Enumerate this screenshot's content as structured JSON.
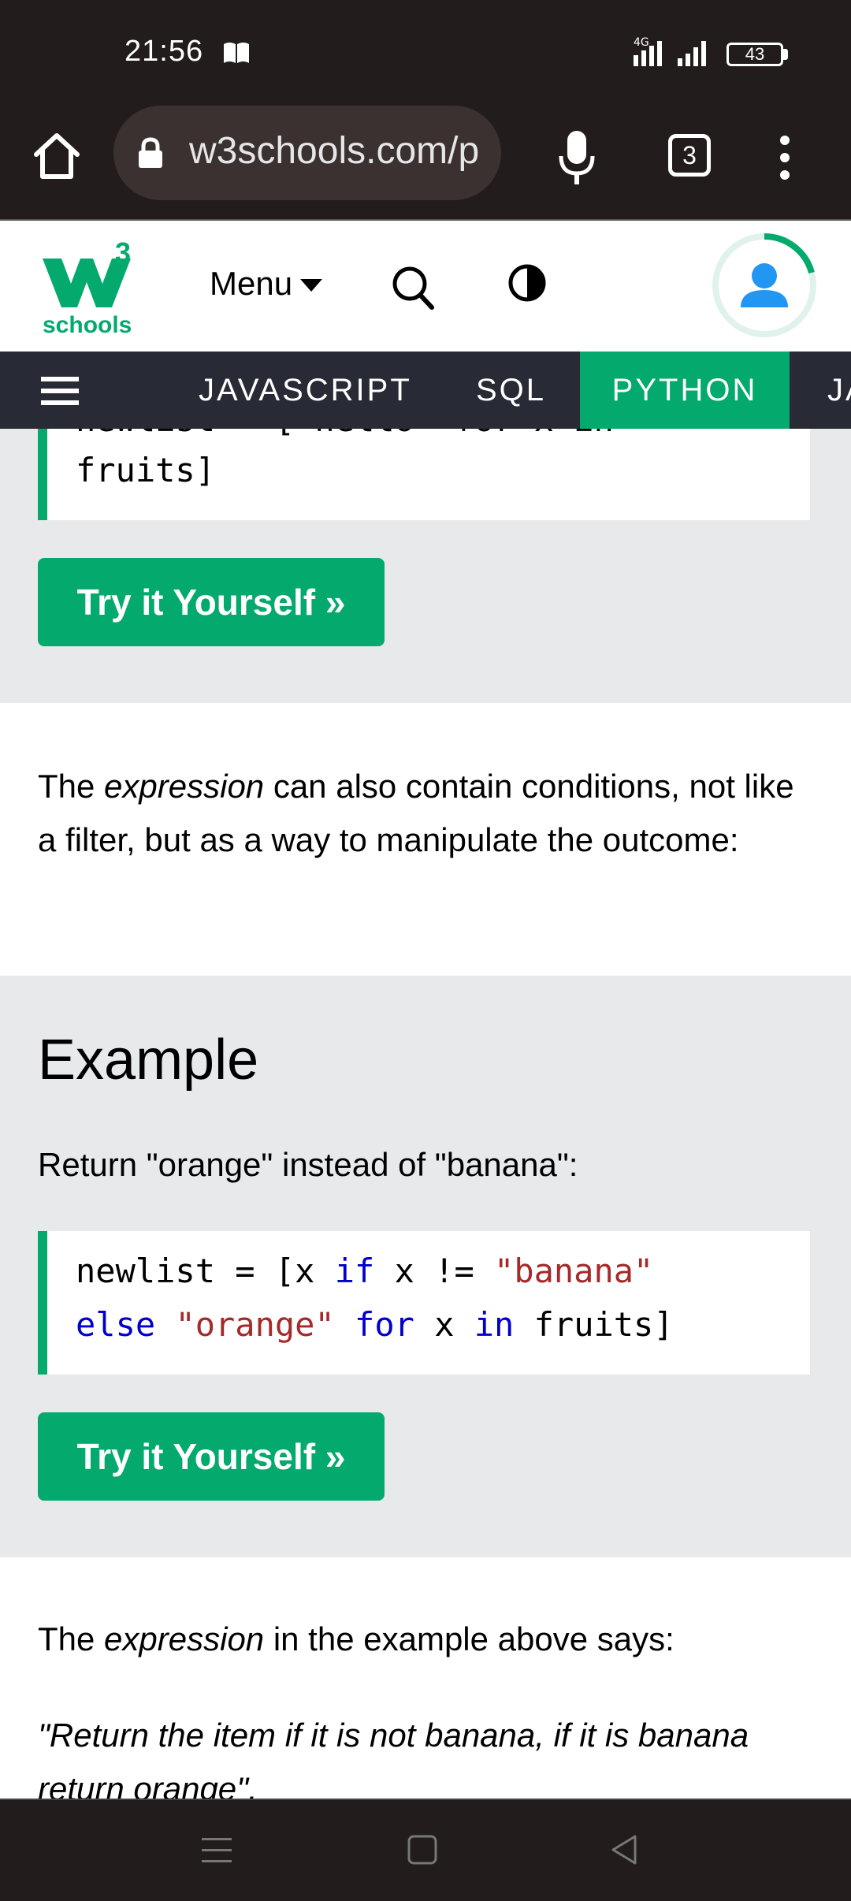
{
  "status": {
    "time": "21:56",
    "network": "4G",
    "battery": "43"
  },
  "browser": {
    "url": "w3schools.com/p",
    "tab_count": "3"
  },
  "site": {
    "logo_sup": "3",
    "logo_text": "schools",
    "menu_label": "Menu",
    "nav": [
      "JAVASCRIPT",
      "SQL",
      "PYTHON",
      "JA"
    ],
    "active_nav": "PYTHON"
  },
  "content": {
    "code1_partial": "newlist = [\"hello\" for x in",
    "code1_line2": "fruits]",
    "try1": "Try it Yourself »",
    "para1_pre": "The ",
    "para1_em": "expression",
    "para1_post": " can also contain conditions, not like a filter, but as a way to manipulate the outcome:",
    "example_heading": "Example",
    "example_desc": "Return \"orange\" instead of \"banana\":",
    "code2": {
      "l1_a": "newlist = [x ",
      "l1_if": "if",
      "l1_b": " x != ",
      "l1_str": "\"banana\"",
      "l2_else": "else",
      "l2_sp": " ",
      "l2_str": "\"orange\"",
      "l2_sp2": " ",
      "l2_for": "for",
      "l2_b": " x ",
      "l2_in": "in",
      "l2_c": " fruits]"
    },
    "try2": "Try it Yourself »",
    "para2_pre": "The ",
    "para2_em": "expression",
    "para2_post": " in the example above says:",
    "quote": "\"Return the item if it is not banana, if it is banana return orange\"."
  },
  "colors": {
    "accent": "#04aa6d",
    "topnav": "#282a35",
    "chrome": "#231c1c",
    "example_bg": "#e7e9eb"
  }
}
